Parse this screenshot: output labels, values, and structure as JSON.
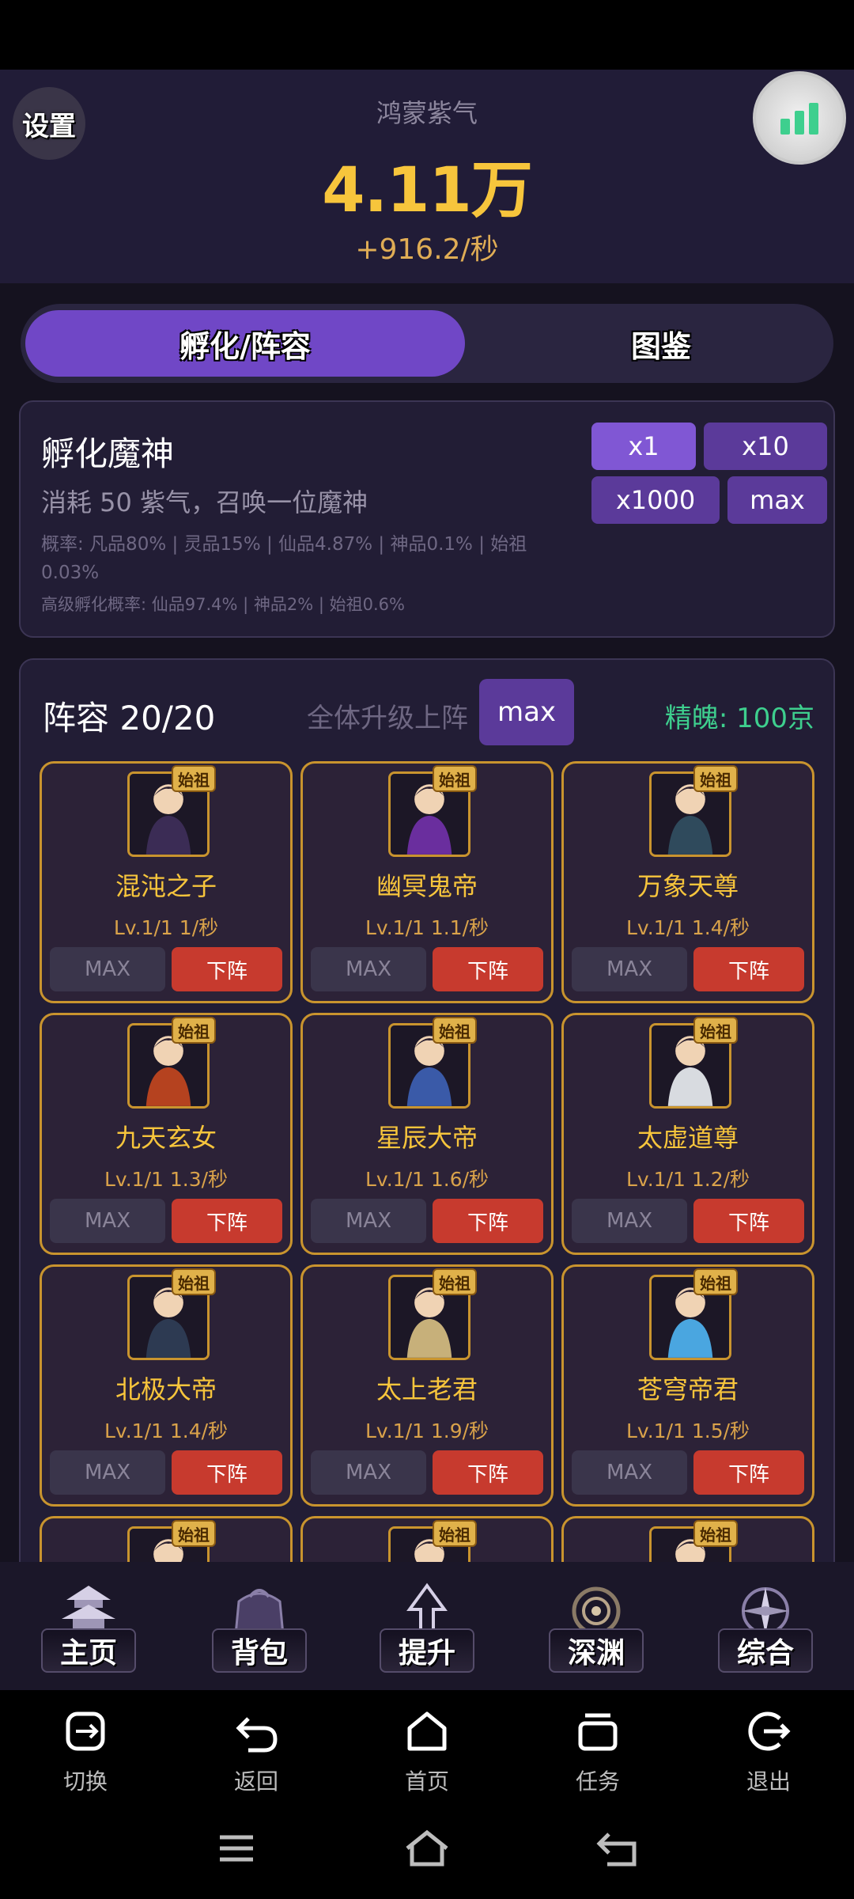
{
  "header": {
    "settings_label": "设置",
    "resource_name": "鸿蒙紫气",
    "resource_amount": "4.11万",
    "resource_rate": "+916.2/秒"
  },
  "tabs": [
    {
      "label": "孵化/阵容",
      "active": true
    },
    {
      "label": "图鉴",
      "active": false
    }
  ],
  "hatch": {
    "title": "孵化魔神",
    "desc": "消耗 50 紫气，召唤一位魔神",
    "prob": "概率: 凡品80% | 灵品15% | 仙品4.87% | 神品0.1% | 始祖0.03%",
    "adv": "高级孵化概率: 仙品97.4% | 神品2% | 始祖0.6%",
    "buttons": [
      "x1",
      "x10",
      "x1000",
      "max"
    ]
  },
  "roster": {
    "title": "阵容 20/20",
    "upgrade_all_label": "全体升级上阵",
    "upgrade_all_button": "max",
    "essence": "精魄: 100京"
  },
  "heroes": [
    {
      "name": "混沌之子",
      "badge": "始祖",
      "level": "Lv.1/1 1/秒",
      "max": "MAX",
      "remove": "下阵",
      "color": "#3b2c55"
    },
    {
      "name": "幽冥鬼帝",
      "badge": "始祖",
      "level": "Lv.1/1 1.1/秒",
      "max": "MAX",
      "remove": "下阵",
      "color": "#6a2e9e"
    },
    {
      "name": "万象天尊",
      "badge": "始祖",
      "level": "Lv.1/1 1.4/秒",
      "max": "MAX",
      "remove": "下阵",
      "color": "#2f4a5c"
    },
    {
      "name": "九天玄女",
      "badge": "始祖",
      "level": "Lv.1/1 1.3/秒",
      "max": "MAX",
      "remove": "下阵",
      "color": "#b5421f"
    },
    {
      "name": "星辰大帝",
      "badge": "始祖",
      "level": "Lv.1/1 1.6/秒",
      "max": "MAX",
      "remove": "下阵",
      "color": "#3a5aa8"
    },
    {
      "name": "太虚道尊",
      "badge": "始祖",
      "level": "Lv.1/1 1.2/秒",
      "max": "MAX",
      "remove": "下阵",
      "color": "#d8dbe0"
    },
    {
      "name": "北极大帝",
      "badge": "始祖",
      "level": "Lv.1/1 1.4/秒",
      "max": "MAX",
      "remove": "下阵",
      "color": "#2d3a52"
    },
    {
      "name": "太上老君",
      "badge": "始祖",
      "level": "Lv.1/1 1.9/秒",
      "max": "MAX",
      "remove": "下阵",
      "color": "#c7b07a"
    },
    {
      "name": "苍穹帝君",
      "badge": "始祖",
      "level": "Lv.1/1 1.5/秒",
      "max": "MAX",
      "remove": "下阵",
      "color": "#4aa6e0"
    },
    {
      "name": "",
      "badge": "始祖",
      "level": "",
      "max": "",
      "remove": "",
      "color": "#5a5a80"
    },
    {
      "name": "",
      "badge": "始祖",
      "level": "",
      "max": "",
      "remove": "",
      "color": "#6b4a3a"
    },
    {
      "name": "",
      "badge": "始祖",
      "level": "",
      "max": "",
      "remove": "",
      "color": "#e8d9c2"
    }
  ],
  "nav": [
    {
      "label": "主页",
      "icon": "pagoda-icon"
    },
    {
      "label": "背包",
      "icon": "bag-icon"
    },
    {
      "label": "提升",
      "icon": "upgrade-arrow-icon"
    },
    {
      "label": "深渊",
      "icon": "vortex-icon"
    },
    {
      "label": "综合",
      "icon": "compass-icon"
    }
  ],
  "system_bar": [
    {
      "label": "切换",
      "icon": "switch-icon"
    },
    {
      "label": "返回",
      "icon": "back-icon"
    },
    {
      "label": "首页",
      "icon": "home-icon"
    },
    {
      "label": "任务",
      "icon": "tasks-icon"
    },
    {
      "label": "退出",
      "icon": "exit-icon"
    }
  ],
  "colors": {
    "accent_purple": "#7047c6",
    "gold": "#f7c53c",
    "green": "#3ecf8e",
    "red": "#c73a2e"
  }
}
